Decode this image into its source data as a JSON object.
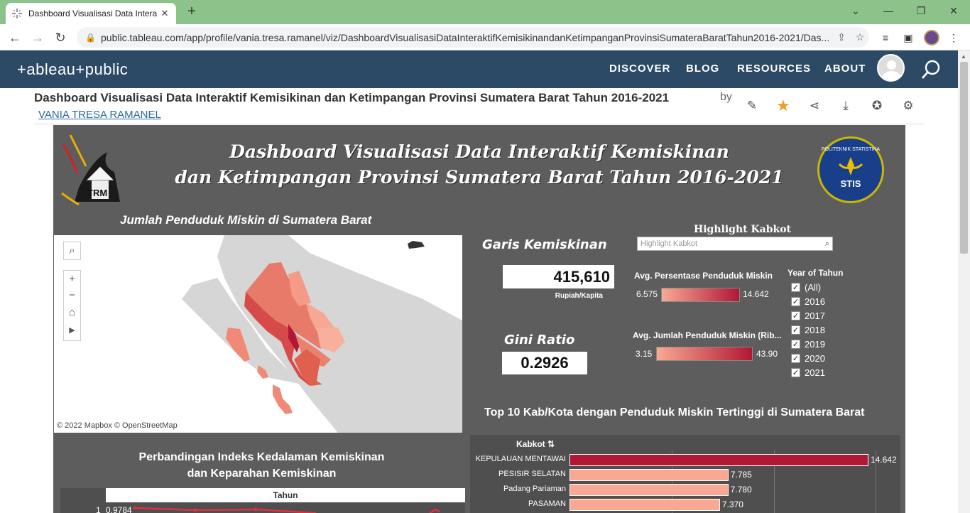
{
  "browser": {
    "tab_title": "Dashboard Visualisasi Data Intera",
    "url": "public.tableau.com/app/profile/vania.tresa.ramanel/viz/DashboardVisualisasiDataInteraktifKemisikinandanKetimpanganProvinsiSumateraBaratTahun2016-2021/Das..."
  },
  "site": {
    "logo": "+ableau+public",
    "nav": [
      "DISCOVER",
      "BLOG",
      "RESOURCES",
      "ABOUT"
    ]
  },
  "viz": {
    "title": "Dashboard Visualisasi Data Interaktif Kemisikinan dan Ketimpangan Provinsi Sumatera Barat Tahun 2016-2021",
    "by": "by",
    "author": "VANIA TRESA RAMANEL"
  },
  "dashboard": {
    "title_line1": "Dashboard Visualisasi Data Interaktif Kemiskinan",
    "title_line2": "dan Ketimpangan Provinsi Sumatera Barat Tahun 2016-2021",
    "left_logo_text": "TRM",
    "stis_ring": "POLITEKNIK STATISTIKA",
    "stis_text": "STIS",
    "map_title": "Jumlah Penduduk Miskin di Sumatera Barat",
    "map_attribution": "© 2022 Mapbox  © OpenStreetMap",
    "garis_label": "Garis Kemiskinan",
    "garis_value": "415,610",
    "garis_unit": "Rupiah/Kapita",
    "gini_label": "Gini Ratio",
    "gini_value": "0.2926",
    "highlight_title": "Highlight Kabkot",
    "highlight_placeholder": "Highlight Kabkot",
    "legend1_title": "Avg. Persentase Penduduk Miskin",
    "legend1_min": "6.575",
    "legend1_max": "14.642",
    "legend2_title": "Avg. Jumlah Penduduk Miskin (Rib...",
    "legend2_min": "3.15",
    "legend2_max": "43.90",
    "year_filter_title": "Year of Tahun",
    "years": [
      "(All)",
      "2016",
      "2017",
      "2018",
      "2019",
      "2020",
      "2021"
    ],
    "top10_title": "Top 10 Kab/Kota dengan Penduduk Miskin Tertinggi di Sumatera Barat",
    "bar_header": "Kabkot",
    "compare_title_line1": "Perbandingan Indeks Kedalaman Kemiskinan",
    "compare_title_line2": "dan Keparahan Kemiskinan",
    "tahun_header": "Tahun",
    "line_first_value": "0.9784",
    "line_axis_tick": "1"
  },
  "colors": {
    "low": "#f9a993",
    "high": "#b01835",
    "dash_bg": "#5d5d5d",
    "header_bg": "#2c4a66"
  },
  "chart_data": {
    "type": "bar",
    "title": "Top 10 Kab/Kota dengan Penduduk Miskin Tertinggi di Sumatera Barat",
    "categories": [
      "KEPULAUAN MENTAWAI",
      "PESISIR SELATAN",
      "Padang Pariaman",
      "PASAMAN"
    ],
    "values": [
      14.642,
      7.785,
      7.78,
      7.37
    ],
    "labels": [
      "14.642",
      "7.785",
      "7.780",
      "7.370"
    ],
    "xlim": [
      0,
      16
    ]
  }
}
